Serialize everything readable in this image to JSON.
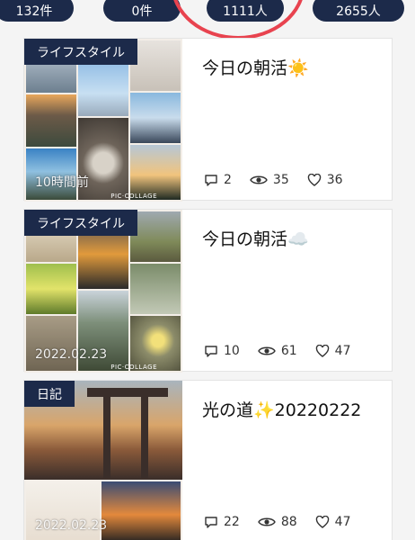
{
  "stats": [
    "132件",
    "0件",
    "1111人",
    "2655人"
  ],
  "articles": [
    {
      "category": "ライフスタイル",
      "title": "今日の朝活☀️",
      "time": "10時間前",
      "collage_label": "PIC·COLLAGE",
      "comments": "2",
      "views": "35",
      "likes": "36"
    },
    {
      "category": "ライフスタイル",
      "title": "今日の朝活☁️",
      "time": "2022.02.23",
      "collage_label": "PIC·COLLAGE",
      "comments": "10",
      "views": "61",
      "likes": "47"
    },
    {
      "category": "日記",
      "title": "光の道✨20220222",
      "time": "2022.02.23",
      "comments": "22",
      "views": "88",
      "likes": "47"
    }
  ],
  "icons": {
    "comment": "comment-icon",
    "view": "eye-icon",
    "like": "heart-icon"
  },
  "colors": {
    "navy": "#1c2a4a",
    "highlight_ring": "#e8434f"
  }
}
